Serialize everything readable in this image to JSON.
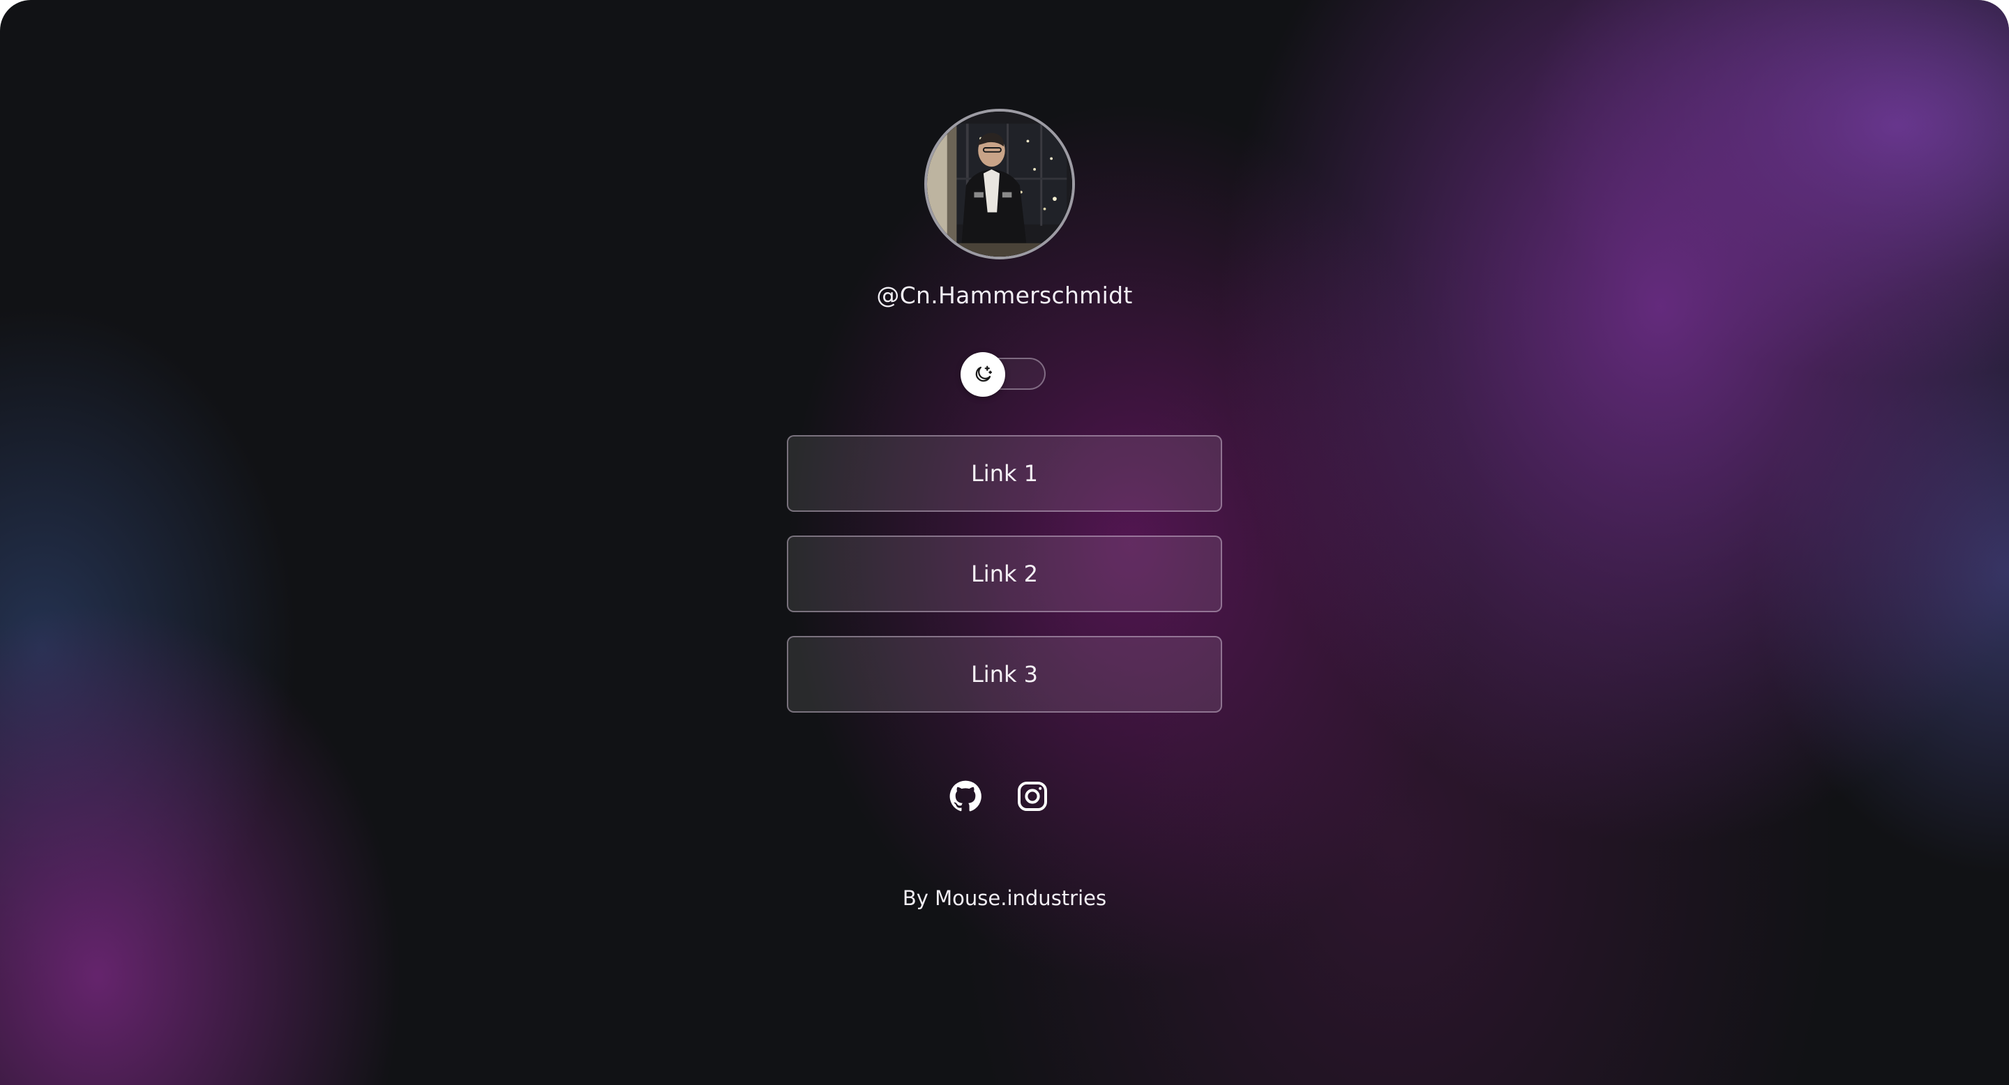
{
  "profile": {
    "username": "@Cn.Hammerschmidt"
  },
  "theme_toggle": {
    "icon": "moon-sparkle-icon",
    "state": "off"
  },
  "links": [
    {
      "label": "Link 1"
    },
    {
      "label": "Link 2"
    },
    {
      "label": "Link 3"
    }
  ],
  "socials": [
    {
      "icon": "github-icon"
    },
    {
      "icon": "instagram-icon"
    }
  ],
  "footer": {
    "credit": "By Mouse.industries"
  },
  "colors": {
    "background_base": "#111215",
    "accent_purple": "#682c82",
    "text": "#f1eef4"
  }
}
